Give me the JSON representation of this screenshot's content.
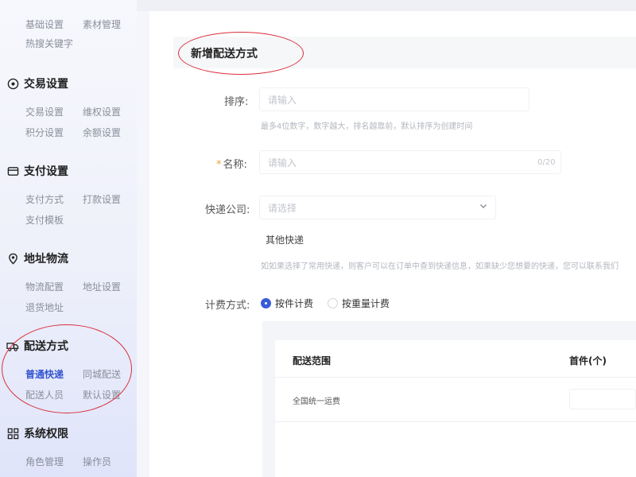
{
  "sidebar": {
    "top_items": [
      "基础设置",
      "素材管理",
      "热搜关键字"
    ],
    "sections": [
      {
        "title": "交易设置",
        "icon": "transaction-icon",
        "items": [
          "交易设置",
          "维权设置",
          "积分设置",
          "余额设置"
        ]
      },
      {
        "title": "支付设置",
        "icon": "card-icon",
        "items": [
          "支付方式",
          "打款设置",
          "支付模板"
        ]
      },
      {
        "title": "地址物流",
        "icon": "location-pin-icon",
        "items": [
          "物流配置",
          "地址设置",
          "退货地址"
        ]
      },
      {
        "title": "配送方式",
        "icon": "truck-icon",
        "items": [
          "普通快递",
          "同城配送",
          "配送人员",
          "默认设置"
        ],
        "active": "普通快递"
      },
      {
        "title": "系统权限",
        "icon": "grid-icon",
        "items": [
          "角色管理",
          "操作员"
        ]
      }
    ]
  },
  "form": {
    "title": "新增配送方式",
    "sort": {
      "label": "排序:",
      "placeholder": "请输入",
      "hint": "最多4位数字，数字越大，排名越靠前，默认排序为创建时间"
    },
    "name": {
      "label": "名称:",
      "placeholder": "请输入",
      "counter": "0/20"
    },
    "express": {
      "label": "快递公司:",
      "placeholder": "请选择",
      "other": "其他快递",
      "hint": "如如果选择了常用快递，则客户可以在订单中查到快递信息，如果缺少您想要的快递，您可以联系我们"
    },
    "billing": {
      "label": "计费方式:",
      "options": [
        "按件计费",
        "按重量计费"
      ],
      "selected": "按件计费"
    },
    "table": {
      "col_range": "配送范围",
      "col_first": "首件(个)",
      "row1_range": "全国统一运费"
    }
  },
  "colors": {
    "accent": "#3a5bd9",
    "annotation": "#d92f3a"
  }
}
